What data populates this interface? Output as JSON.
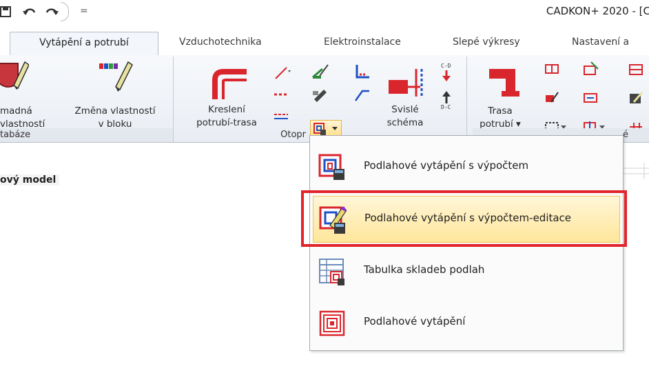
{
  "window": {
    "title": "CADKON+ 2020 - [C"
  },
  "quick_access": {
    "icons": [
      "save-icon",
      "undo-icon",
      "redo-icon"
    ],
    "separator": "="
  },
  "tabs": [
    {
      "label": "Vytápění a potrubí",
      "active": true
    },
    {
      "label": "Vzduchotechnika"
    },
    {
      "label": "Elektroinstalace"
    },
    {
      "label": "Slepé výkresy"
    },
    {
      "label": "Nastavení a"
    }
  ],
  "ribbon": {
    "groups": [
      {
        "label": "tabáze",
        "buttons": [
          {
            "label_line1": "madná",
            "label_line2": "vlastností"
          },
          {
            "label_line1": "Změna vlastností",
            "label_line2": "v bloku"
          }
        ]
      },
      {
        "label": "Otopr",
        "buttons": [
          {
            "label_line1": "Kreslení",
            "label_line2": "potrubí-trasa"
          },
          {
            "label_line1": "Svislé",
            "label_line2": "schéma"
          }
        ]
      },
      {
        "label": "é",
        "buttons": [
          {
            "label_line1": "Trasa",
            "label_line2": "potrubí"
          }
        ]
      }
    ]
  },
  "canvas": {
    "model_label": "ový model"
  },
  "dropdown": {
    "items": [
      {
        "label": "Podlahové vytápění s výpočtem",
        "icon": "floor-heating-calc-icon"
      },
      {
        "label": "Podlahové vytápění s výpočtem-editace",
        "icon": "floor-heating-calc-edit-icon",
        "highlighted": true
      },
      {
        "label": "Tabulka skladeb podlah",
        "icon": "floor-table-icon"
      },
      {
        "label": "Podlahové vytápění",
        "icon": "floor-heating-icon"
      }
    ]
  },
  "colors": {
    "highlight_border": "#e2232a",
    "hover_fill": "#ffe69a",
    "pipe_red": "#d9262c"
  }
}
